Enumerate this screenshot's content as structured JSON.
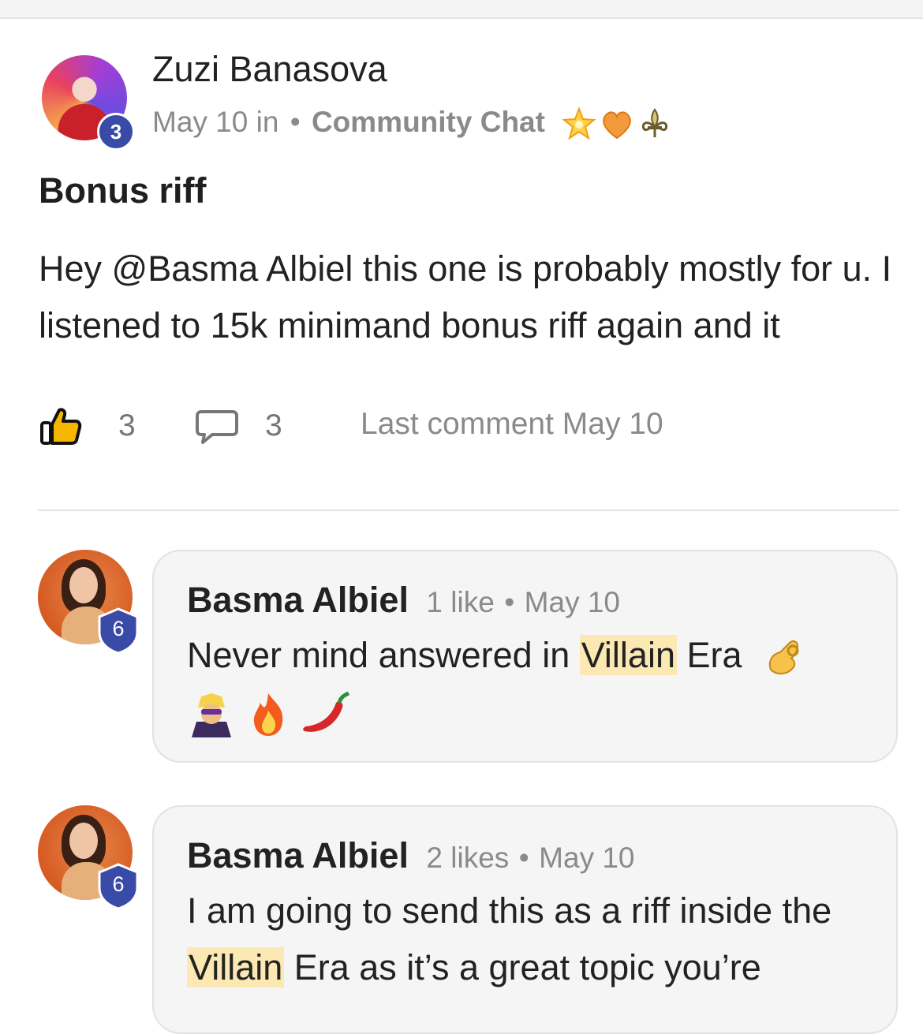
{
  "post": {
    "author": "Zuzi Banasova",
    "author_level": "3",
    "date": "May 10 in",
    "dot": "•",
    "group": "Community Chat",
    "flair_icons": [
      "glowing-star-icon",
      "orange-heart-icon",
      "fleur-de-lis-icon"
    ],
    "title": "Bonus riff",
    "body": "Hey @Basma Albiel this one is probably mostly for u. I listened to 15k minimand bonus riff again and it",
    "likes": "3",
    "comments": "3",
    "last_comment": "Last comment May 10"
  },
  "comments": [
    {
      "author": "Basma Albiel",
      "level": "6",
      "likes": "1 like",
      "dot": "•",
      "date": "May 10",
      "text_before": "Never mind answered in ",
      "highlight": "Villain",
      "text_after": " Era",
      "emoji_icons": [
        "pinching-hand-icon",
        "supervillain-icon",
        "fire-icon",
        "hot-pepper-icon"
      ]
    },
    {
      "author": "Basma Albiel",
      "level": "6",
      "likes": "2 likes",
      "dot": "•",
      "date": "May 10",
      "text_before": "I am going to send this as a riff inside the ",
      "highlight": "Villain",
      "text_after": " Era as it’s a great topic you’re"
    }
  ],
  "colors": {
    "badge_blue": "#3a4aa7",
    "highlight": "#fbe8b3",
    "bubble_bg": "#f5f5f5",
    "muted_text": "#8a8a8a"
  }
}
